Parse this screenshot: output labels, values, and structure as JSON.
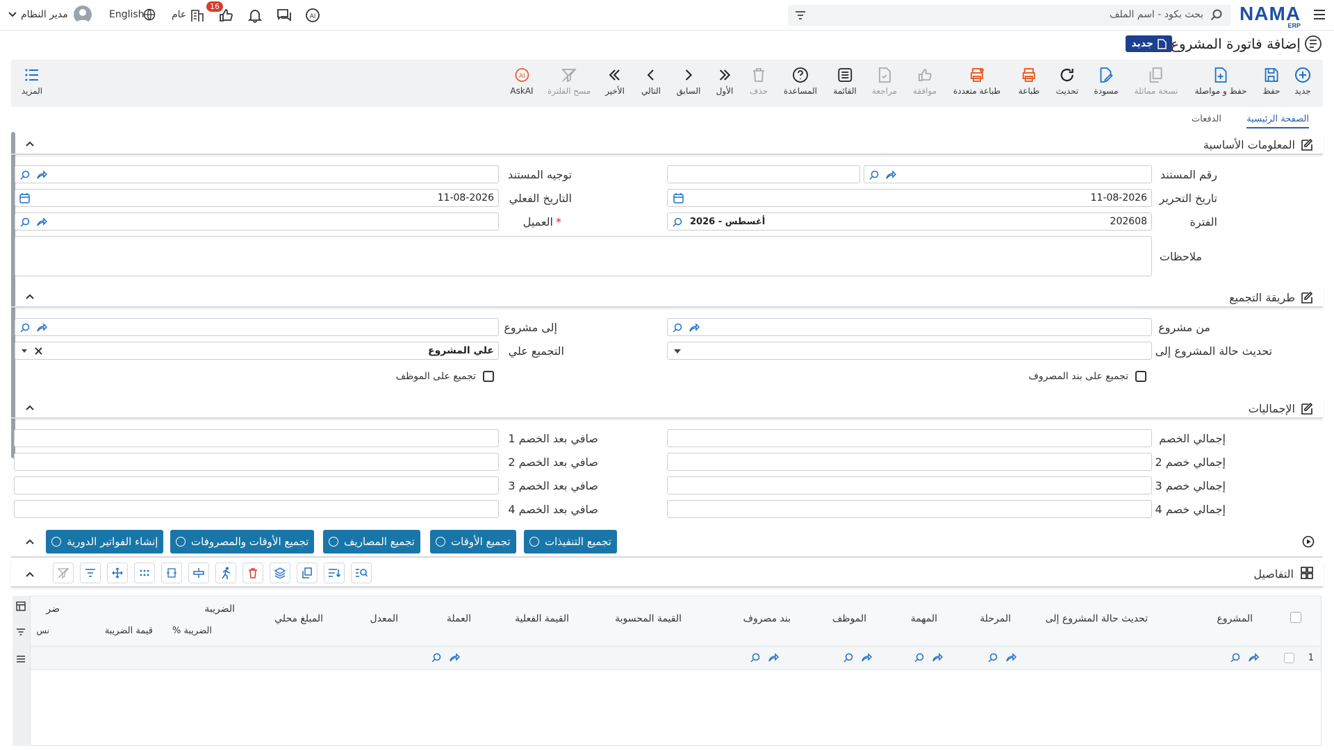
{
  "topbar": {
    "search_placeholder": "بحث بكود - اسم الملف",
    "logo": "NAMA",
    "logo_sub": "ERP",
    "user": "مدير النظام",
    "language": "English",
    "general": "عام",
    "badge_count": "16"
  },
  "page": {
    "title": "إضافة فاتورة المشروع",
    "badge": "جديد"
  },
  "toolbar": {
    "new": "جديد",
    "save": "حفظ",
    "save_continue": "حفظ و مواصلة",
    "copy": "نسخة مماثلة",
    "draft": "مسودة",
    "refresh": "تحديث",
    "print": "طباعة",
    "multi_print": "طباعة متعددة",
    "approve": "موافقة",
    "review": "مراجعة",
    "list": "القائمة",
    "help": "المساعدة",
    "delete": "حذف",
    "first": "الأول",
    "prev": "السابق",
    "next": "التالي",
    "last": "الأخير",
    "clear_filter": "مسح الفلترة",
    "askai": "AskAI",
    "more": "المزيد"
  },
  "tabs": {
    "main": "الصفحة الرئيسية",
    "payments": "الدفعات"
  },
  "basic": {
    "header": "المعلومات الأساسية",
    "doc_number": "رقم المستند",
    "doc_direction": "توجيه المستند",
    "edit_date": "تاريخ التحرير",
    "edit_date_value": "11-08-2026",
    "actual_date": "التاريخ الفعلي",
    "actual_date_value": "11-08-2026",
    "period": "الفترة",
    "period_value": "202608",
    "period_name": "2026 - أغسطس",
    "customer": "العميل",
    "notes": "ملاحظات"
  },
  "grouping": {
    "header": "طريقة التجميع",
    "from_project": "من مشروع",
    "to_project": "إلى مشروع",
    "update_status": "تحديث حالة المشروع إلى",
    "group_by": "التجميع علي",
    "group_by_value": "علي المشروع",
    "by_expense": "تجميع على بند المصروف",
    "by_employee": "تجميع على الموظف"
  },
  "totals": {
    "header": "الإجماليات",
    "total_discount": "إجمالي الخصم",
    "net_after_1": "صافي بعد الخصم 1",
    "total_discount_2": "إجمالي خصم 2",
    "net_after_2": "صافي بعد الخصم 2",
    "total_discount_3": "إجمالي خصم 3",
    "net_after_3": "صافي بعد الخصم 3",
    "total_discount_4": "إجمالي خصم 4",
    "net_after_4": "صافي بعد الخصم 4"
  },
  "actions": {
    "collect_exec": "تجميع التنفيذات",
    "collect_times": "تجميع الأوقات",
    "collect_expenses": "تجميع المصاريف",
    "collect_times_expenses": "تجميع الأوقات والمصروفات",
    "create_periodic": "إنشاء الفواتير الدورية"
  },
  "details": {
    "header": "التفاصيل",
    "columns": [
      "المشروع",
      "تحديث حالة المشروع إلى",
      "المرحلة",
      "المهمة",
      "الموظف",
      "بند مصروف",
      "القيمة المحسوبة",
      "القيمة الفعلية",
      "العملة",
      "المعدل",
      "المبلغ محلي"
    ],
    "tax_group": "الضريبة",
    "tax_pct": "% الضريبة",
    "tax_value": "قيمة الضريبة",
    "tax_trunc": "ضر",
    "tax_trunc2": "نس",
    "row_num": "1"
  },
  "colors": {
    "accent": "#1976a8",
    "brand": "#1d3f8f",
    "danger": "#d93a2b",
    "orange": "#e8622c"
  }
}
